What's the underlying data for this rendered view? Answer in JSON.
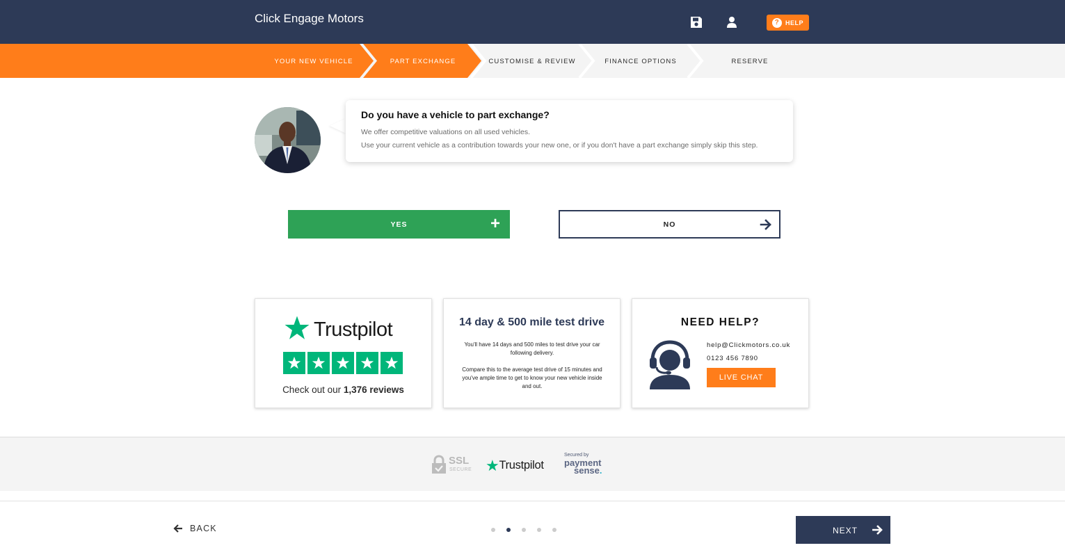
{
  "header": {
    "title": "Click Engage Motors",
    "save_icon": "save-icon",
    "user_icon": "user-icon",
    "help_label": "HELP"
  },
  "steps": {
    "items": [
      {
        "label": "YOUR NEW VEHICLE",
        "state": "complete"
      },
      {
        "label": "PART EXCHANGE",
        "state": "current"
      },
      {
        "label": "CUSTOMISE & REVIEW",
        "state": "upcoming"
      },
      {
        "label": "FINANCE OPTIONS",
        "state": "upcoming"
      },
      {
        "label": "RESERVE",
        "state": "upcoming"
      }
    ],
    "active_color": "#ff7d1a"
  },
  "intro": {
    "question": "Do you have a vehicle to part exchange?",
    "line1": "We offer competitive valuations on all used vehicles.",
    "line2": "Use your current vehicle as a contribution towards your new one, or if you don't have a part exchange simply skip this step."
  },
  "choices": {
    "yes_label": "YES",
    "no_label": "NO",
    "yes_color": "#2ea256"
  },
  "cards": {
    "trustpilot": {
      "brand": "Trustpilot",
      "reviews_prefix": "Check out our ",
      "reviews_count": "1,376 reviews",
      "stars": 5
    },
    "test_drive": {
      "title": "14 day & 500 mile test drive",
      "para1": "You'll have 14 days and 500 miles to test drive your car following delivery.",
      "para2": "Compare this to the average test drive of 15 minutes and you've ample time to get to know your new vehicle inside and out."
    },
    "need_help": {
      "title": "NEED HELP?",
      "email": "help@Clickmotors.co.uk",
      "phone": "0123 456 7890",
      "chat_label": "LIVE CHAT"
    }
  },
  "trust_strip": {
    "ssl_big": "SSL",
    "ssl_small": "SECURE",
    "trustpilot": "Trustpilot",
    "pay_secured": "Secured by",
    "pay_word1": "payment",
    "pay_word2": "sense",
    "pay_dot": "."
  },
  "footer": {
    "back_label": "BACK",
    "next_label": "NEXT",
    "page_dots": 5,
    "active_dot": 2
  }
}
